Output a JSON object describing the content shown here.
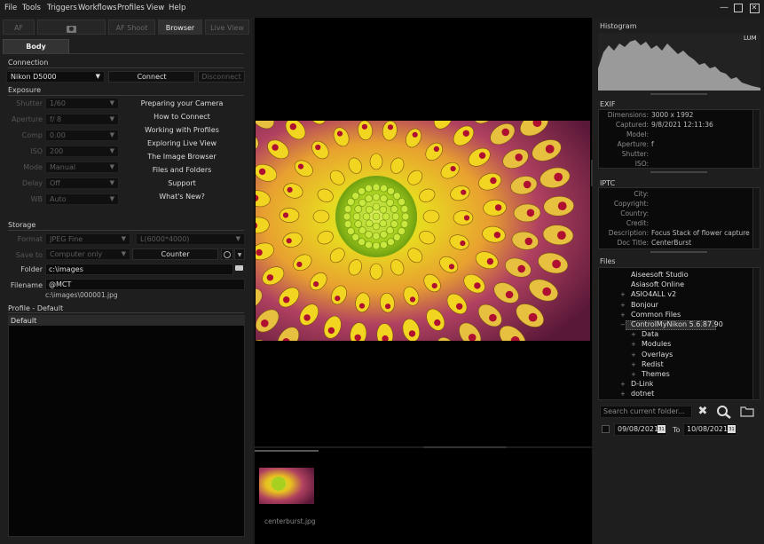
{
  "menu": [
    "File",
    "Tools",
    "Triggers",
    "Workflows",
    "Profiles",
    "View",
    "Help"
  ],
  "mode_tabs": [
    "AF",
    "",
    "AF Shoot",
    "Browser",
    "Live View"
  ],
  "body_tab": "Body",
  "connection": {
    "title": "Connection",
    "camera": "Nikon D5000",
    "connect": "Connect",
    "disconnect": "Disconnect"
  },
  "exposure": {
    "title": "Exposure",
    "rows": [
      {
        "label": "Shutter",
        "value": "1/60"
      },
      {
        "label": "Aperture",
        "value": "f/ 8"
      },
      {
        "label": "Comp",
        "value": "0.00"
      },
      {
        "label": "ISO",
        "value": "200"
      },
      {
        "label": "Mode",
        "value": "Manual"
      },
      {
        "label": "Delay",
        "value": "Off"
      },
      {
        "label": "WB",
        "value": "Auto"
      }
    ]
  },
  "help_links": [
    "Preparing your Camera",
    "How to Connect",
    "Working with Profiles",
    "Exploring Live View",
    "The Image Browser",
    "Files and Folders",
    "Support",
    "What's New?"
  ],
  "storage": {
    "title": "Storage",
    "format_label": "Format",
    "format_value": "JPEG Fine",
    "size_value": "L(6000*4000)",
    "save_label": "Save to",
    "save_value": "Computer only",
    "counter": "Counter",
    "folder_label": "Folder",
    "folder_value": "c:\\images",
    "filename_label": "Filename",
    "filename_value": "@MCT",
    "path_preview": "c:\\images\\000001.jpg"
  },
  "profile": {
    "title": "Profile - Default",
    "header": "Default"
  },
  "thumbnail": {
    "name": "centerburst.jpg"
  },
  "histogram": {
    "title": "Histogram",
    "mode": "LUM"
  },
  "exif": {
    "title": "EXIF",
    "rows": [
      {
        "k": "Dimensions:",
        "v": "3000 x 1992"
      },
      {
        "k": "Captured:",
        "v": "9/8/2021 12:11:36"
      },
      {
        "k": "Model:",
        "v": ""
      },
      {
        "k": "Aperture:",
        "v": "f"
      },
      {
        "k": "Shutter:",
        "v": ""
      },
      {
        "k": "ISO:",
        "v": ""
      }
    ]
  },
  "iptc": {
    "title": "IPTC",
    "rows": [
      {
        "k": "City:",
        "v": ""
      },
      {
        "k": "Copyright:",
        "v": ""
      },
      {
        "k": "Country:",
        "v": ""
      },
      {
        "k": "Credit:",
        "v": ""
      },
      {
        "k": "Description:",
        "v": "Focus Stack of flower capture..."
      },
      {
        "k": "Doc Title:",
        "v": "CenterBurst"
      }
    ]
  },
  "files": {
    "title": "Files",
    "tree": [
      {
        "label": "Aiseesoft Studio",
        "depth": 0,
        "expander": ""
      },
      {
        "label": "Asiasoft Online",
        "depth": 0,
        "expander": ""
      },
      {
        "label": "ASIO4ALL v2",
        "depth": 0,
        "expander": "+"
      },
      {
        "label": "Bonjour",
        "depth": 0,
        "expander": "+"
      },
      {
        "label": "Common Files",
        "depth": 0,
        "expander": "+"
      },
      {
        "label": "ControlMyNikon 5.6.87.90",
        "depth": 0,
        "expander": "-"
      },
      {
        "label": "Data",
        "depth": 1,
        "expander": "+"
      },
      {
        "label": "Modules",
        "depth": 1,
        "expander": "+"
      },
      {
        "label": "Overlays",
        "depth": 1,
        "expander": "+"
      },
      {
        "label": "Redist",
        "depth": 1,
        "expander": "+"
      },
      {
        "label": "Themes",
        "depth": 1,
        "expander": "+"
      },
      {
        "label": "D-Link",
        "depth": 0,
        "expander": "+"
      },
      {
        "label": "dotnet",
        "depth": 0,
        "expander": "+"
      }
    ],
    "search_placeholder": "Search current folder...",
    "date_from": "09/08/2021",
    "to_label": "To",
    "date_to": "10/08/2021",
    "calendar_day": "31"
  }
}
